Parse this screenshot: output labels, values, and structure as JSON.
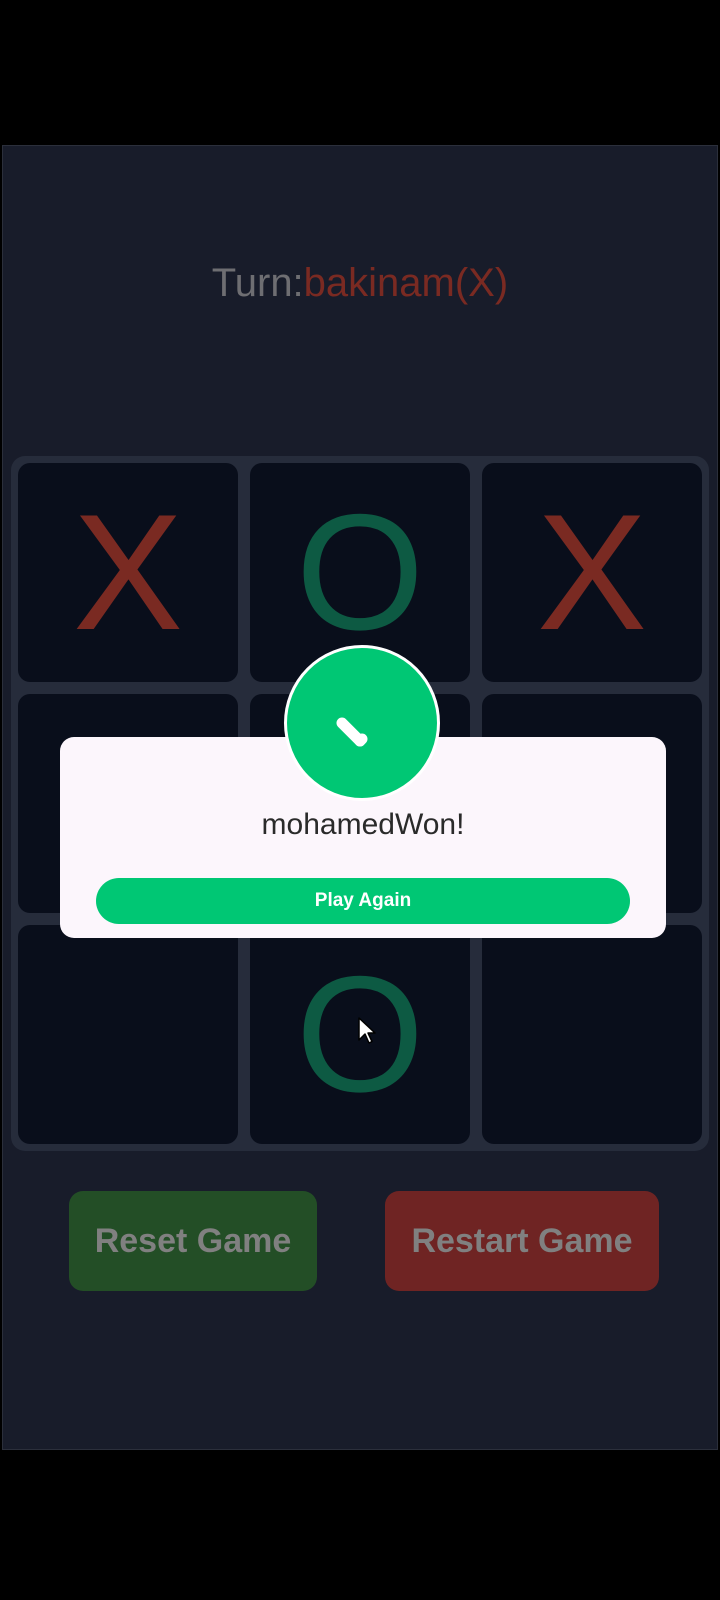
{
  "turn": {
    "prefix": "Turn:",
    "player": "bakinam(X)"
  },
  "board": {
    "cells": [
      "X",
      "O",
      "X",
      "",
      "",
      "",
      "",
      "O",
      ""
    ]
  },
  "buttons": {
    "reset_label": "Reset Game",
    "restart_label": "Restart Game"
  },
  "dialog": {
    "message": "mohamedWon!",
    "play_again_label": "Play Again",
    "icon": "check-icon"
  },
  "colors": {
    "background": "#181c2a",
    "x_color": "#7a2a22",
    "o_color": "#0d5a43",
    "success": "#00c774",
    "reset_bg": "#234e26",
    "restart_bg": "#6f2423"
  }
}
